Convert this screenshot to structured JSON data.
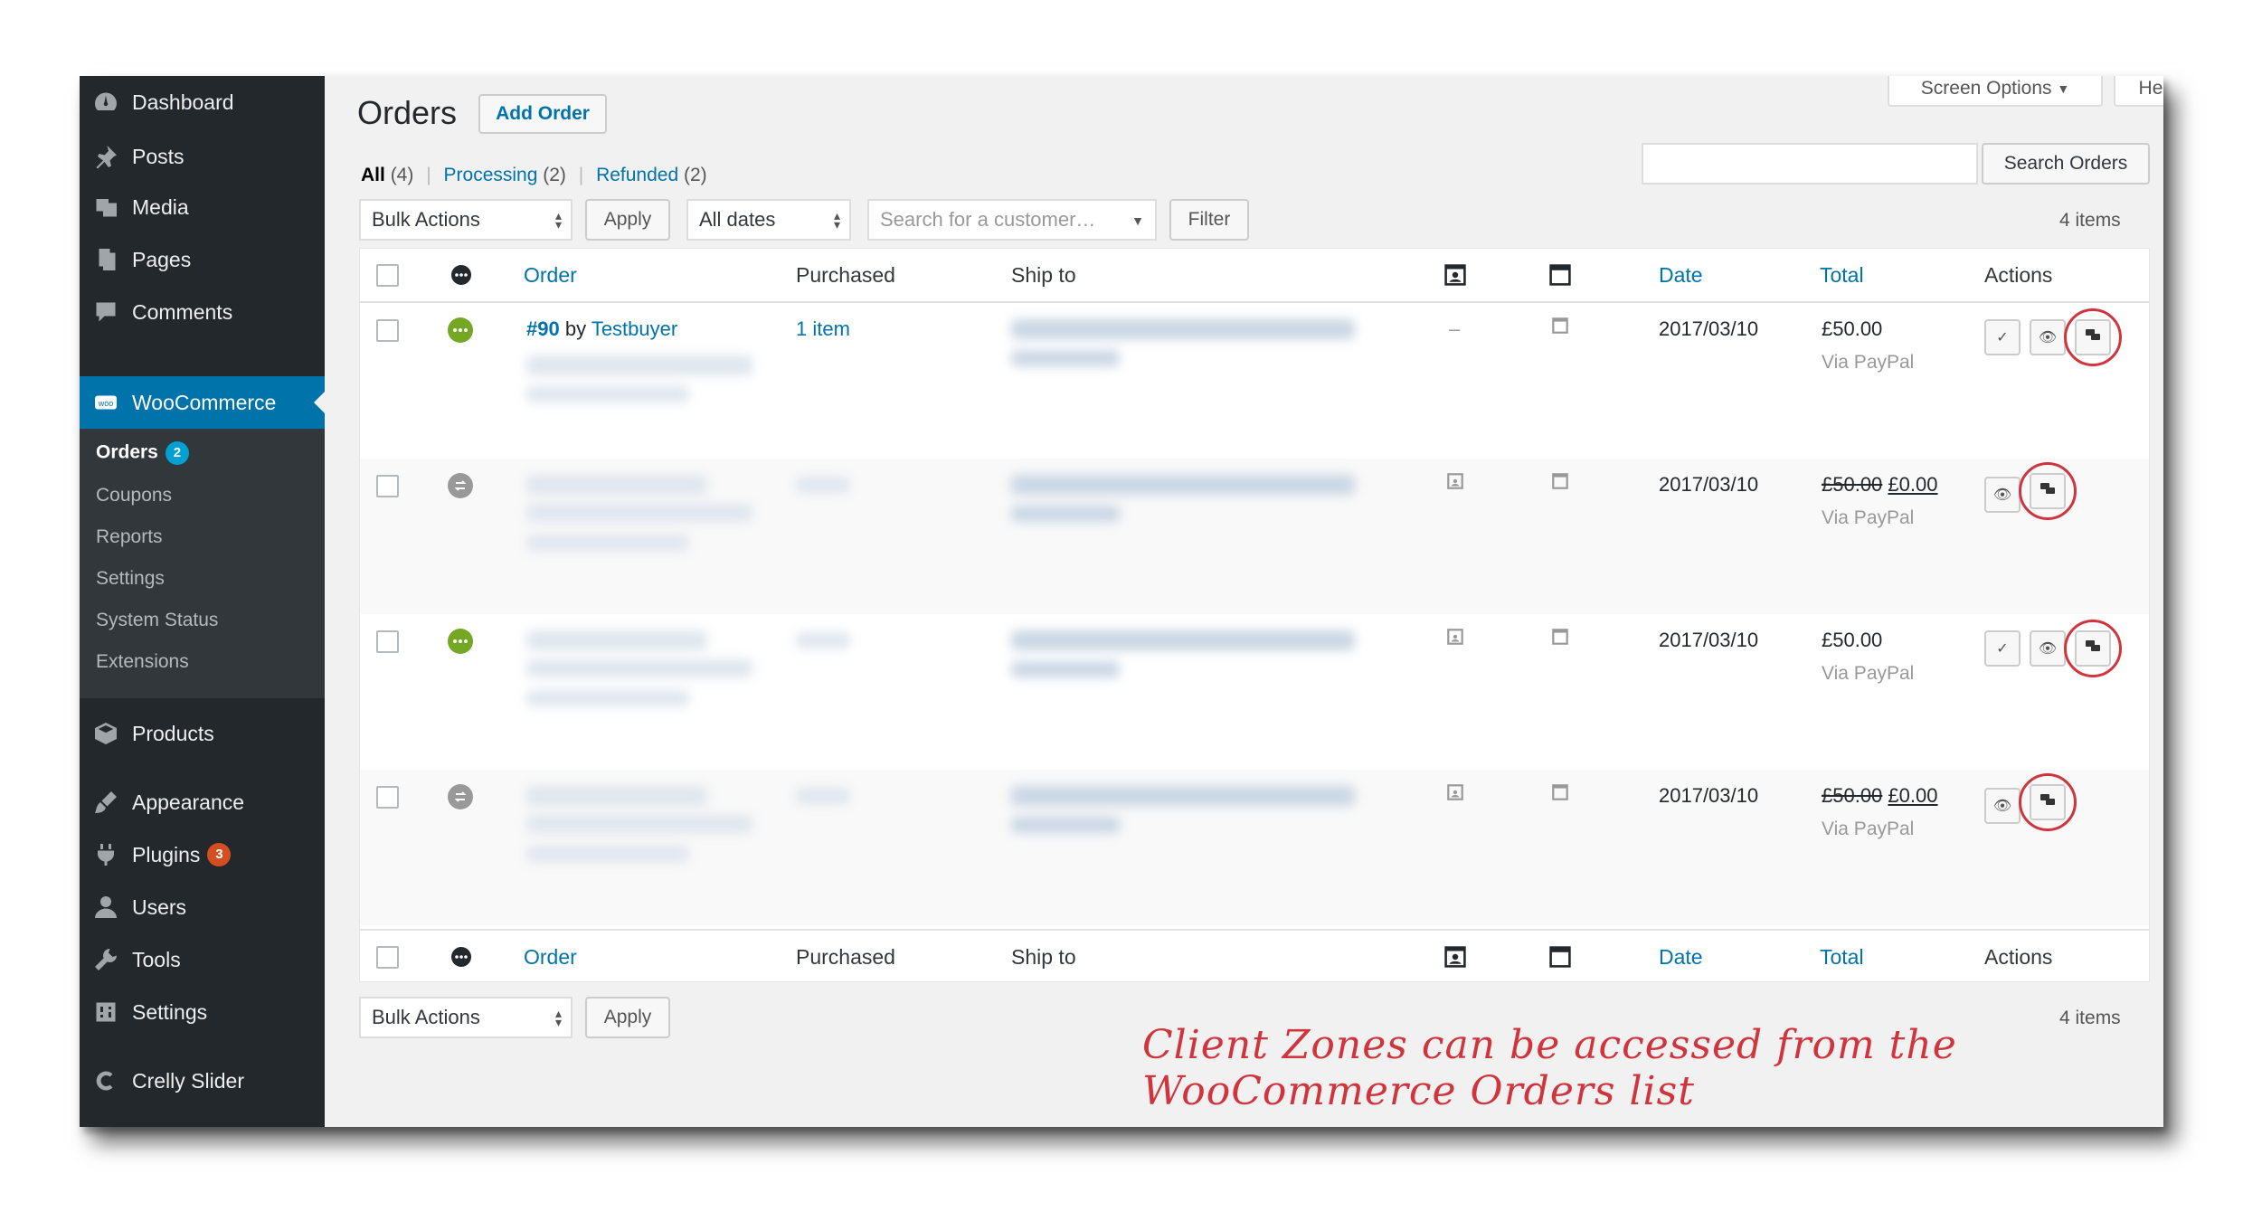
{
  "sidebar": {
    "items": [
      {
        "label": "Dashboard",
        "icon": "dashboard-icon"
      },
      {
        "label": "Posts",
        "icon": "pin-icon"
      },
      {
        "label": "Media",
        "icon": "media-icon"
      },
      {
        "label": "Pages",
        "icon": "pages-icon"
      },
      {
        "label": "Comments",
        "icon": "comment-icon"
      },
      {
        "label": "WooCommerce",
        "icon": "woo-icon"
      },
      {
        "label": "Products",
        "icon": "box-icon"
      },
      {
        "label": "Appearance",
        "icon": "brush-icon"
      },
      {
        "label": "Plugins",
        "icon": "plug-icon",
        "badge": "3"
      },
      {
        "label": "Users",
        "icon": "user-icon"
      },
      {
        "label": "Tools",
        "icon": "wrench-icon"
      },
      {
        "label": "Settings",
        "icon": "settings-icon"
      },
      {
        "label": "Crelly Slider",
        "icon": "crelly-icon"
      }
    ],
    "submenu": [
      {
        "label": "Orders",
        "badge": "2"
      },
      {
        "label": "Coupons"
      },
      {
        "label": "Reports"
      },
      {
        "label": "Settings"
      },
      {
        "label": "System Status"
      },
      {
        "label": "Extensions"
      }
    ]
  },
  "header": {
    "title": "Orders",
    "add_button": "Add Order",
    "screen_options": "Screen Options",
    "help": "Help"
  },
  "filters": {
    "all": "All",
    "all_count": "(4)",
    "processing": "Processing",
    "processing_count": "(2)",
    "refunded": "Refunded",
    "refunded_count": "(2)",
    "sep": "|"
  },
  "search": {
    "button": "Search Orders",
    "value": ""
  },
  "toolbar": {
    "bulk_actions": "Bulk Actions",
    "apply": "Apply",
    "all_dates": "All dates",
    "customer_placeholder": "Search for a customer…",
    "filter": "Filter",
    "items_count": "4 items"
  },
  "table": {
    "columns": {
      "order": "Order",
      "purchased": "Purchased",
      "ship_to": "Ship to",
      "date": "Date",
      "total": "Total",
      "actions": "Actions"
    },
    "rows": [
      {
        "status": "processing",
        "order_num": "#90",
        "by": "by",
        "customer": "Testbuyer",
        "purchased": "1 item",
        "billing": "–",
        "date": "2017/03/10",
        "total": "£50.00",
        "total_new": "",
        "via": "Via PayPal"
      },
      {
        "status": "refunded",
        "order_num": "",
        "by": "",
        "customer": "",
        "purchased": "",
        "billing": "",
        "date": "2017/03/10",
        "total": "£50.00",
        "total_new": "£0.00",
        "via": "Via PayPal"
      },
      {
        "status": "processing",
        "order_num": "",
        "by": "",
        "customer": "",
        "purchased": "",
        "billing": "",
        "date": "2017/03/10",
        "total": "£50.00",
        "total_new": "",
        "via": "Via PayPal"
      },
      {
        "status": "refunded",
        "order_num": "",
        "by": "",
        "customer": "",
        "purchased": "",
        "billing": "",
        "date": "2017/03/10",
        "total": "£50.00",
        "total_new": "£0.00",
        "via": "Via PayPal"
      }
    ]
  },
  "bottom": {
    "bulk_actions": "Bulk Actions",
    "apply": "Apply",
    "items_count": "4 items"
  },
  "caption": "Client Zones can be accessed from the WooCommerce Orders list",
  "colors": {
    "sidebar": "#23282d",
    "accent": "#0073aa",
    "processing": "#73a724",
    "highlight": "#d0353d"
  }
}
